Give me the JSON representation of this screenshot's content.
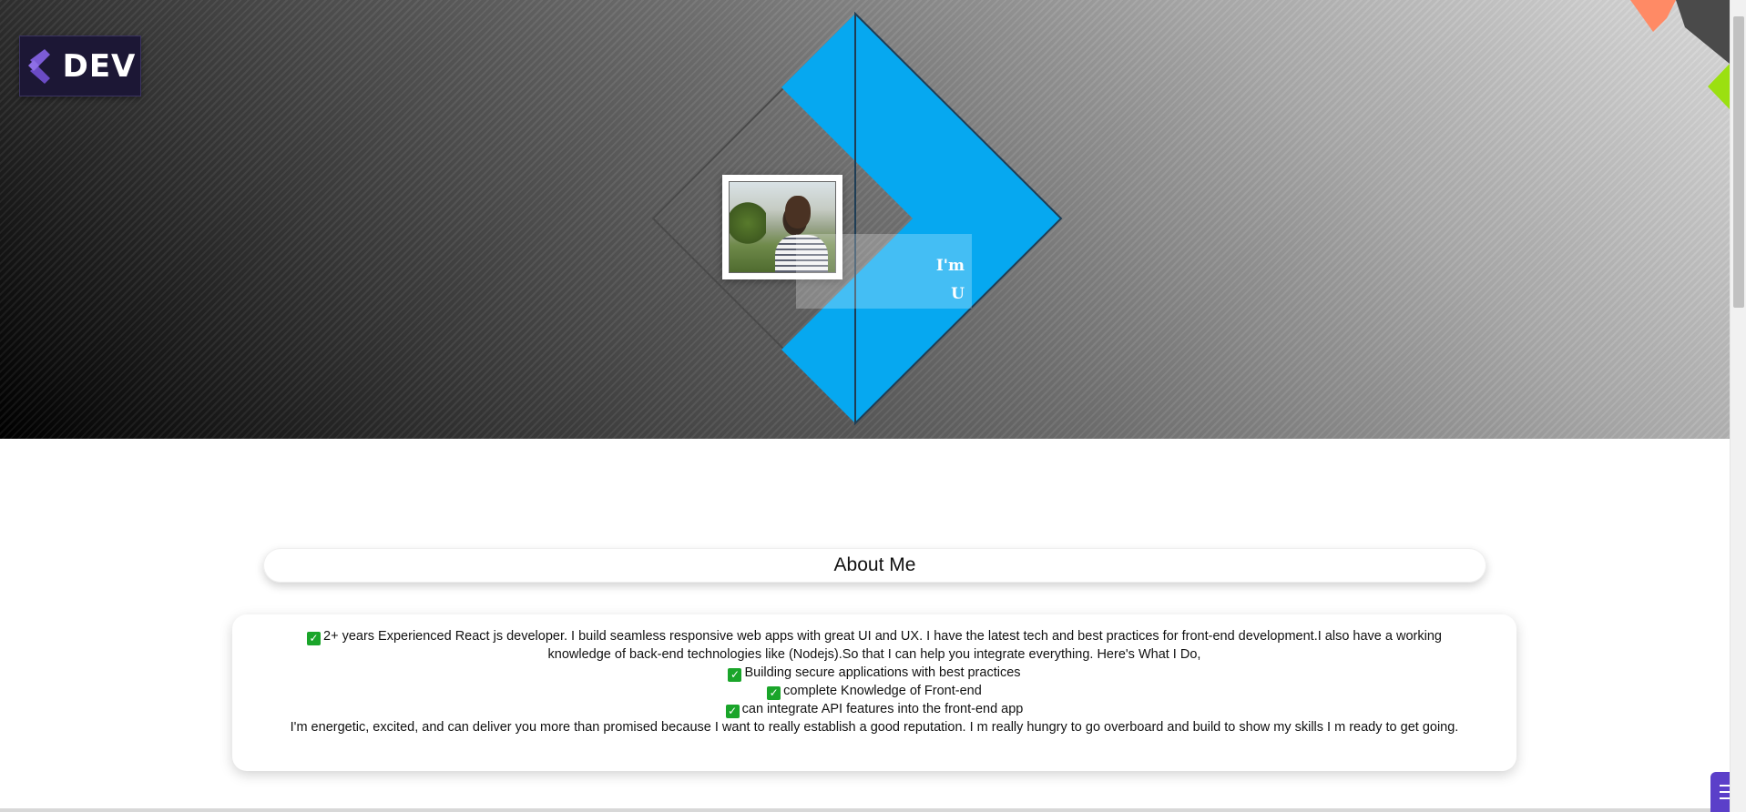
{
  "header": {
    "logo_text": "DEV",
    "logo_colors": {
      "background": "#1c1735",
      "mark": "#7c5cd6"
    }
  },
  "hero": {
    "intro_line_1": "I'm",
    "intro_line_2": "U",
    "accent_color": "#06a8f0",
    "photo_alt": "Profile photo"
  },
  "about": {
    "heading": "About Me",
    "intro_paragraph": "2+ years Experienced React js developer. I build seamless responsive web apps with great UI and UX. I have the latest tech and best practices for front-end development.I also have a working knowledge of back-end technologies like (Nodejs).So that I can help you integrate everything. Here's What I Do,",
    "points": [
      "Building secure applications with best practices",
      "complete Knowledge of Front-end",
      "can integrate API features into the front-end app"
    ],
    "closing_paragraph": "I'm energetic, excited, and can deliver you more than promised because I want to really establish a good reputation. I m really hungry to go overboard and build to show my skills I m ready to get going.",
    "check_symbol": "✓"
  },
  "icons": {
    "menu": "hamburger-menu-icon",
    "check": "check-mark-icon"
  },
  "colors": {
    "menu_button": "#5b3fc9",
    "check_badge": "#1aa52a",
    "corner_orange": "#ff8a65",
    "corner_green": "#9be010"
  }
}
